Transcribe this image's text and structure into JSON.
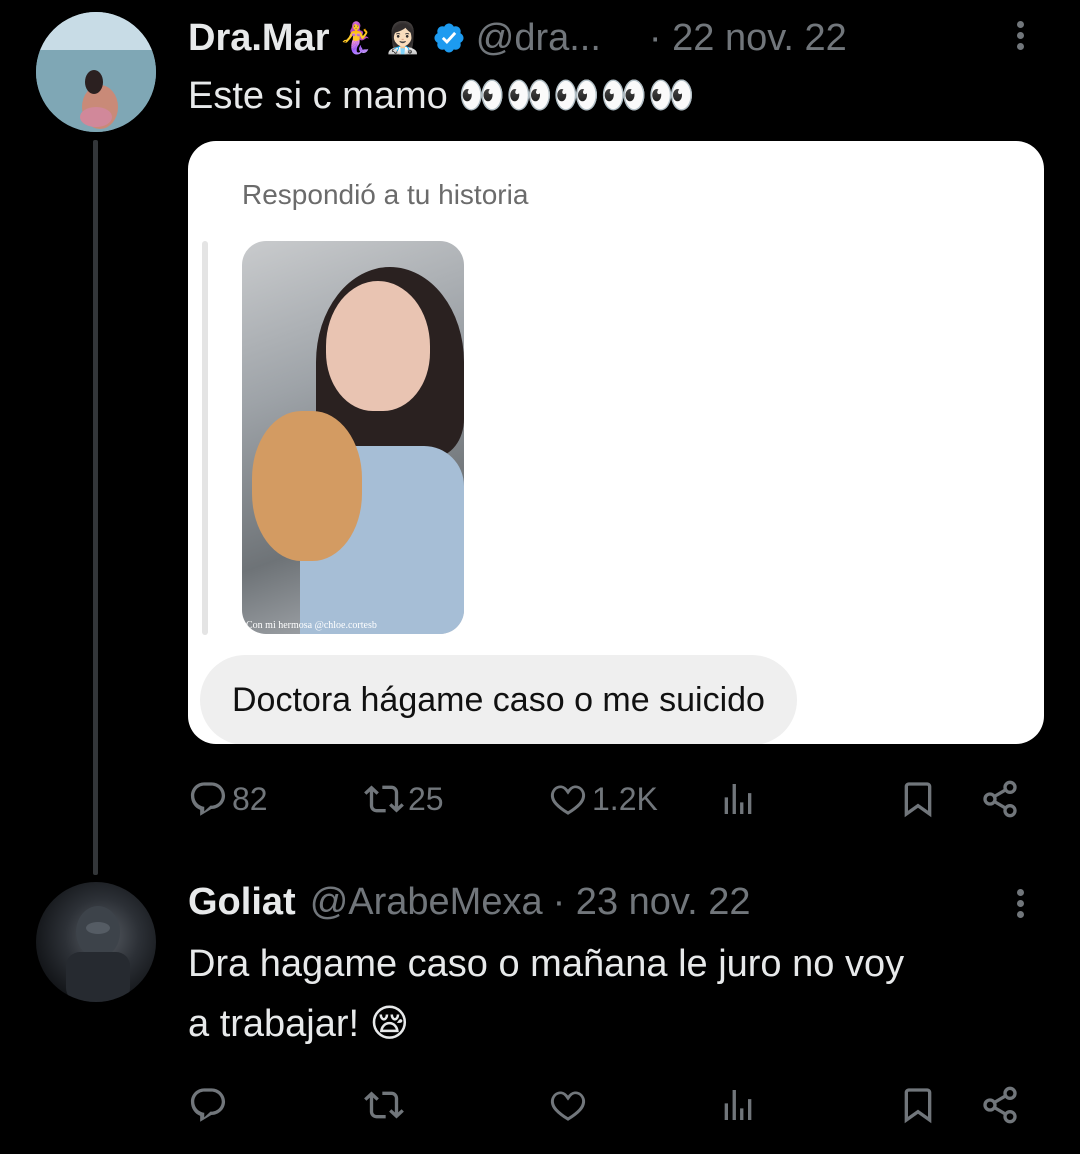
{
  "tweet1": {
    "name": "Dra.Mar",
    "name_emojis": "🧜‍♀️ 👩🏻‍⚕️",
    "handle": "@dra...",
    "date": "· 22 nov. 22",
    "text": "Este si c mamo 👀👀👀👀👀",
    "card": {
      "label": "Respondió a tu historia",
      "story_caption": "Con mi hermosa @chloe.cortesb",
      "message": "Doctora hágame caso o me suicido"
    },
    "actions": {
      "replies": "82",
      "retweets": "25",
      "likes": "1.2K"
    }
  },
  "tweet2": {
    "name": "Goliat",
    "handle": "@ArabeMexa",
    "date": "· 23 nov. 22",
    "text_line1": "Dra hagame caso o mañana le juro no voy",
    "text_line2": "a trabajar! 😪"
  },
  "colors": {
    "background": "#000000",
    "text": "#e7e9ea",
    "secondary": "#71767b",
    "verified": "#1d9bf0"
  },
  "icons": [
    "reply-icon",
    "retweet-icon",
    "like-icon",
    "views-icon",
    "bookmark-icon",
    "share-icon",
    "more-icon",
    "verified-icon"
  ]
}
